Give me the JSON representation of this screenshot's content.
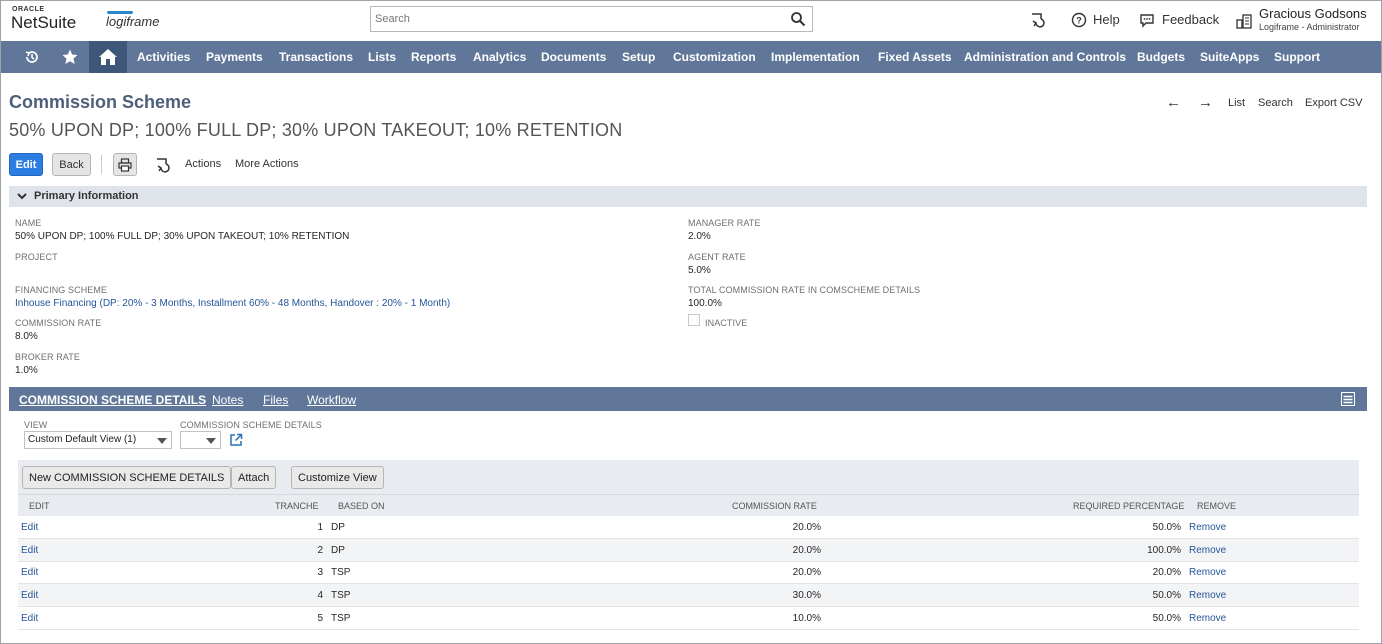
{
  "header": {
    "oracle": "ORACLE",
    "netsuite": "NetSuite",
    "partner_logo": "logiframe",
    "search_placeholder": "Search",
    "help": "Help",
    "feedback": "Feedback",
    "user_name": "Gracious Godsons",
    "user_role": "Logiframe - Administrator"
  },
  "nav": {
    "items": [
      "Activities",
      "Payments",
      "Transactions",
      "Lists",
      "Reports",
      "Analytics",
      "Documents",
      "Setup",
      "Customization",
      "Implementation",
      "Fixed Assets",
      "Administration and Controls",
      "Budgets",
      "SuiteApps",
      "Support"
    ]
  },
  "page": {
    "label": "Commission Scheme",
    "title": "50% UPON DP; 100% FULL DP; 30% UPON TAKEOUT; 10% RETENTION",
    "right_links": [
      "List",
      "Search",
      "Export CSV"
    ],
    "buttons": {
      "edit": "Edit",
      "back": "Back",
      "actions": "Actions",
      "more_actions": "More Actions"
    }
  },
  "primary": {
    "section_label": "Primary Information",
    "name_label": "NAME",
    "name_value": "50% UPON DP; 100% FULL DP; 30% UPON TAKEOUT; 10% RETENTION",
    "project_label": "PROJECT",
    "financing_label": "FINANCING SCHEME",
    "financing_value": "Inhouse Financing (DP: 20% - 3 Months, Installment 60% - 48 Months, Handover : 20% - 1 Month)",
    "commission_rate_label": "COMMISSION RATE",
    "commission_rate_value": "8.0%",
    "broker_rate_label": "BROKER RATE",
    "broker_rate_value": "1.0%",
    "manager_rate_label": "MANAGER RATE",
    "manager_rate_value": "2.0%",
    "agent_rate_label": "AGENT RATE",
    "agent_rate_value": "5.0%",
    "total_rate_label": "TOTAL COMMISSION RATE IN COMSCHEME DETAILS",
    "total_rate_value": "100.0%",
    "inactive_label": "INACTIVE"
  },
  "subtabs": {
    "items": [
      "COMMISSION SCHEME DETAILS",
      "Notes",
      "Files",
      "Workflow"
    ],
    "view_label": "VIEW",
    "view_value": "Custom Default View (1)",
    "csd_label": "COMMISSION SCHEME DETAILS"
  },
  "sublist": {
    "buttons": [
      "New COMMISSION SCHEME DETAILS",
      "Attach",
      "Customize View"
    ],
    "columns": [
      "EDIT",
      "TRANCHE",
      "BASED ON",
      "COMMISSION RATE",
      "REQUIRED PERCENTAGE",
      "REMOVE"
    ],
    "rows": [
      {
        "edit": "Edit",
        "tranche": "1",
        "based_on": "DP",
        "commission_rate": "20.0%",
        "required": "50.0%",
        "remove": "Remove"
      },
      {
        "edit": "Edit",
        "tranche": "2",
        "based_on": "DP",
        "commission_rate": "20.0%",
        "required": "100.0%",
        "remove": "Remove"
      },
      {
        "edit": "Edit",
        "tranche": "3",
        "based_on": "TSP",
        "commission_rate": "20.0%",
        "required": "20.0%",
        "remove": "Remove"
      },
      {
        "edit": "Edit",
        "tranche": "4",
        "based_on": "TSP",
        "commission_rate": "30.0%",
        "required": "50.0%",
        "remove": "Remove"
      },
      {
        "edit": "Edit",
        "tranche": "5",
        "based_on": "TSP",
        "commission_rate": "10.0%",
        "required": "50.0%",
        "remove": "Remove"
      }
    ]
  },
  "colors": {
    "nav_bg": "#607799",
    "nav_home": "#3e5679",
    "primary_button": "#2b7de1",
    "link": "#255599",
    "title": "#4d5f79"
  },
  "icons": [
    "search-icon",
    "recent-records-icon",
    "help-icon",
    "feedback-icon",
    "roles-icon",
    "history-icon",
    "star-icon",
    "home-icon",
    "print-icon",
    "list-menu-icon",
    "open-external-icon"
  ]
}
